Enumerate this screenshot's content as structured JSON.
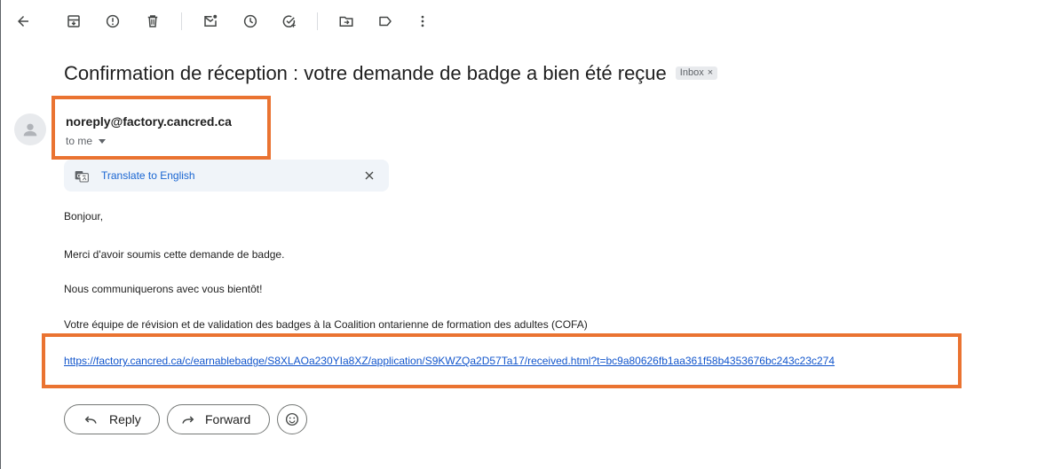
{
  "toolbar": {
    "icons": [
      "back-arrow-icon",
      "archive-icon",
      "report-spam-icon",
      "delete-icon",
      "mark-unread-icon",
      "snooze-icon",
      "add-to-tasks-icon",
      "move-to-icon",
      "label-icon",
      "more-vert-icon"
    ]
  },
  "email": {
    "subject": "Confirmation de réception : votre demande de badge a bien été reçue",
    "label_chip": "Inbox",
    "label_chip_close": "×",
    "sender": "noreply@factory.cancred.ca",
    "recipient": "to me"
  },
  "translate_bar": {
    "link": "Translate to English",
    "close": "✕"
  },
  "body": {
    "greeting": "Bonjour,",
    "line1": "Merci d'avoir soumis cette demande de badge.",
    "line2": "Nous communiquerons avec vous bientôt!",
    "signature": "Votre équipe de révision et de validation des badges à la Coalition ontarienne de formation des adultes (COFA)",
    "link": "https://factory.cancred.ca/c/earnablebadge/S8XLAOa230YIa8XZ/application/S9KWZQa2D57Ta17/received.html?t=bc9a80626fb1aa361f58b4353676bc243c23c274"
  },
  "actions": {
    "reply": "Reply",
    "forward": "Forward"
  },
  "colors": {
    "highlight": "#ea7331",
    "link": "#1155cc"
  }
}
